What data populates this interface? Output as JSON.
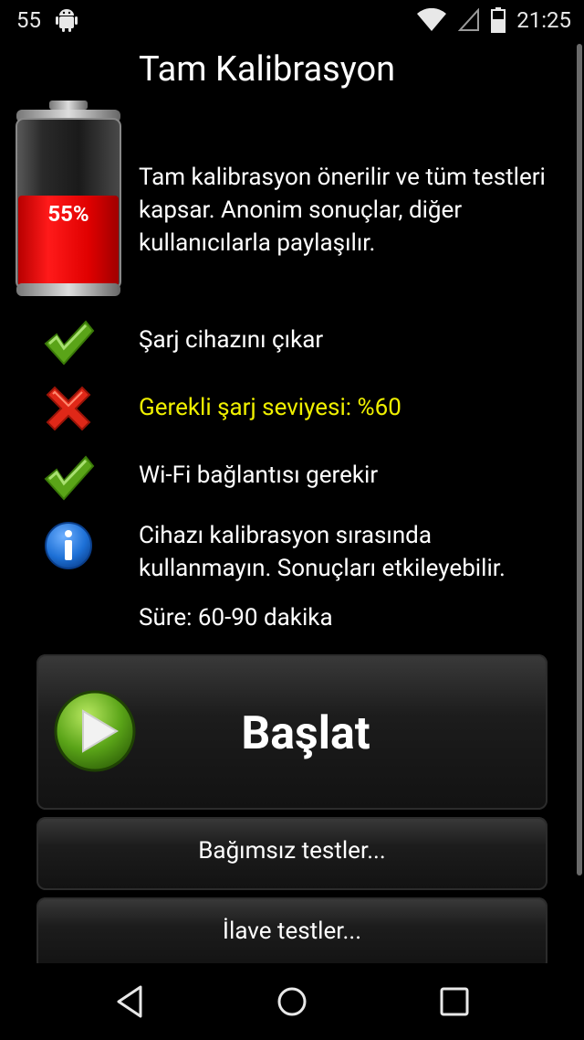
{
  "status_bar": {
    "notification_count": "55",
    "time": "21:25"
  },
  "page": {
    "title": "Tam Kalibrasyon",
    "battery_level_text": "55%",
    "battery_level": 0.55,
    "intro": "Tam kalibrasyon önerilir ve tüm testleri kapsar. Anonim sonuçlar, diğer kullanıcılarla paylaşılır."
  },
  "requirements": [
    {
      "icon": "check-icon",
      "text": "Şarj cihazını çıkar",
      "status": "ok"
    },
    {
      "icon": "cross-icon",
      "text": "Gerekli şarj seviyesi: %60",
      "status": "fail"
    },
    {
      "icon": "check-icon",
      "text": "Wi-Fi bağlantısı gerekir",
      "status": "ok"
    },
    {
      "icon": "info-icon",
      "text": "Cihazı kalibrasyon sırasında kullanmayın. Sonuçları etkileyebilir.",
      "status": "info"
    }
  ],
  "duration": "Süre: 60-90 dakika",
  "buttons": {
    "start": "Başlat",
    "independent_tests": "Bağımsız testler...",
    "extra_tests": "İlave testler..."
  },
  "colors": {
    "warning_text": "#f0f000",
    "battery_fill": "#e00000",
    "check_green": "#5aa418",
    "cross_red": "#e02818",
    "info_blue": "#1d70d6"
  }
}
